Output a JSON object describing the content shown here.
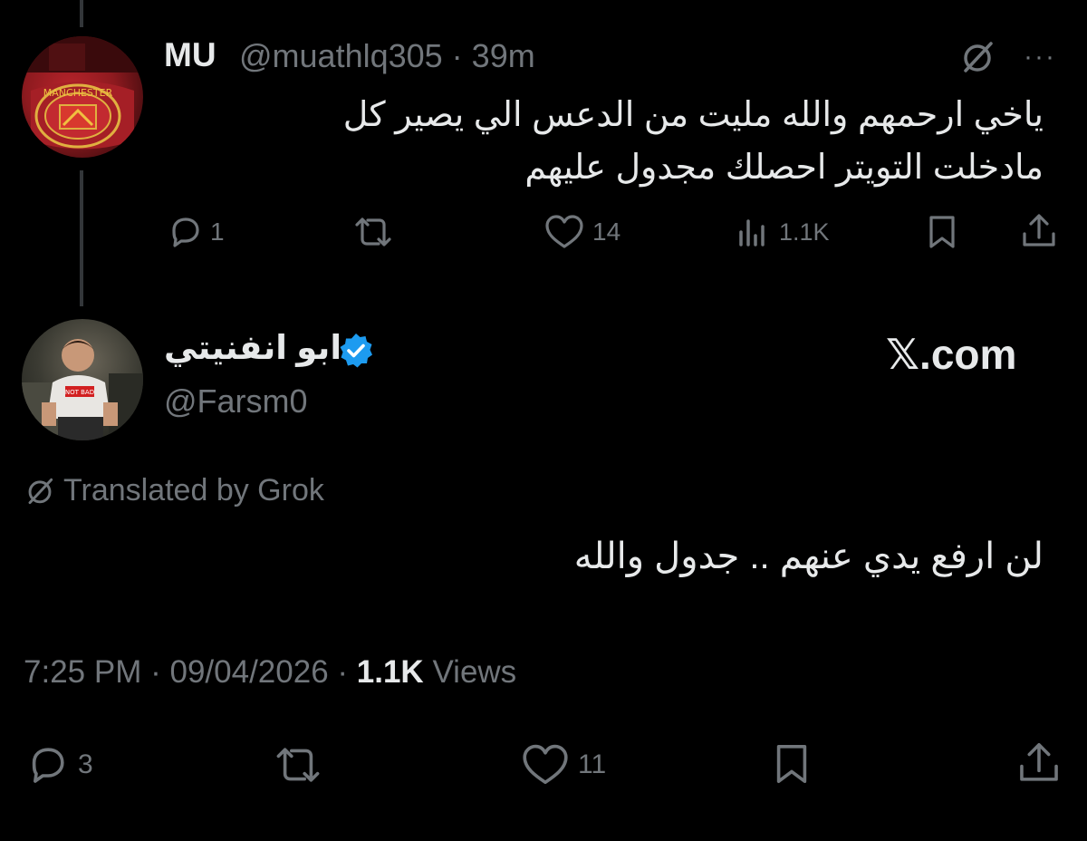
{
  "tweet1": {
    "author_name": "MU",
    "handle_time": "@muathlq305 · 39m",
    "text_line1": "ياخي ارحمهم والله مليت من الدعس الي يصير كل",
    "text_line2": "مادخلت التويتر احصلك مجدول عليهم",
    "more_label": "···",
    "stats": {
      "replies": "1",
      "reposts": "",
      "likes": "14",
      "views": "1.1K"
    }
  },
  "tweet2": {
    "author_name": "ابو انفنيتي",
    "handle": "@Farsm0",
    "watermark": "𝕏.com",
    "translated_label": "Translated by Grok",
    "text": "لن ارفع يدي عنهم .. جدول والله",
    "time": "7:25 PM",
    "date": "09/04/2026",
    "views_count": "1.1K",
    "views_label": "Views",
    "stats": {
      "replies": "3",
      "reposts": "",
      "likes": "11"
    }
  },
  "colors": {
    "background": "#000000",
    "text": "#e7e9ea",
    "muted": "#71767b",
    "verified": "#1d9bf0"
  }
}
